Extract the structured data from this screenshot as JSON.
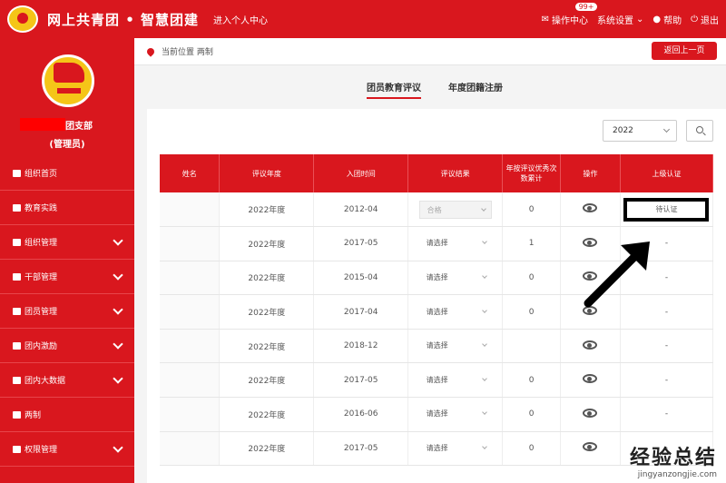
{
  "header": {
    "title": "网上共青团 • 智慧团建",
    "personal_center": "进入个人中心",
    "ops_center": "操作中心",
    "ops_badge": "99+",
    "settings": "系统设置",
    "help": "帮助",
    "logout": "退出"
  },
  "sidebar": {
    "org_name": "团支部",
    "role": "(管理员)",
    "items": [
      {
        "label": "组织首页",
        "icon": "home-icon",
        "expandable": false
      },
      {
        "label": "教育实践",
        "icon": "folder-icon",
        "expandable": false
      },
      {
        "label": "组织管理",
        "icon": "org-icon",
        "expandable": true
      },
      {
        "label": "干部管理",
        "icon": "people-icon",
        "expandable": true
      },
      {
        "label": "团员管理",
        "icon": "people-icon",
        "expandable": true
      },
      {
        "label": "团内激励",
        "icon": "org-icon",
        "expandable": true
      },
      {
        "label": "团内大数据",
        "icon": "folder-icon",
        "expandable": true
      },
      {
        "label": "两制",
        "icon": "home-icon",
        "expandable": false
      },
      {
        "label": "权限管理",
        "icon": "people-icon",
        "expandable": true
      }
    ]
  },
  "breadcrumb": {
    "label": "当前位置 两制",
    "back_button": "返回上一页"
  },
  "tabs": [
    {
      "label": "团员教育评议",
      "active": true
    },
    {
      "label": "年度团籍注册",
      "active": false
    }
  ],
  "filter": {
    "year": "2022"
  },
  "table": {
    "headers": [
      "姓名",
      "评议年度",
      "入团时间",
      "评议结果",
      "年按评议优秀次数累计",
      "操作",
      "上级认证"
    ],
    "rows": [
      {
        "name": "",
        "year": "2022年度",
        "joined": "2012-04",
        "result": "合格",
        "disabled": true,
        "count": "0",
        "cert": "待认证"
      },
      {
        "name": "",
        "year": "2022年度",
        "joined": "2017-05",
        "result": "请选择",
        "disabled": false,
        "count": "1",
        "cert": "-"
      },
      {
        "name": "",
        "year": "2022年度",
        "joined": "2015-04",
        "result": "请选择",
        "disabled": false,
        "count": "0",
        "cert": "-"
      },
      {
        "name": "",
        "year": "2022年度",
        "joined": "2017-04",
        "result": "请选择",
        "disabled": false,
        "count": "0",
        "cert": "-"
      },
      {
        "name": "",
        "year": "2022年度",
        "joined": "2018-12",
        "result": "请选择",
        "disabled": false,
        "count": "",
        "cert": "-"
      },
      {
        "name": "",
        "year": "2022年度",
        "joined": "2017-05",
        "result": "请选择",
        "disabled": false,
        "count": "0",
        "cert": "-"
      },
      {
        "name": "",
        "year": "2022年度",
        "joined": "2016-06",
        "result": "请选择",
        "disabled": false,
        "count": "0",
        "cert": "-"
      },
      {
        "name": "",
        "year": "2022年度",
        "joined": "2017-05",
        "result": "请选择",
        "disabled": false,
        "count": "0",
        "cert": "-"
      }
    ]
  },
  "watermark": {
    "brand": "经验总结",
    "url": "jingyanzongjie.com"
  },
  "colors": {
    "brand_red": "#d9171e",
    "badge_yellow": "#f5c518"
  }
}
